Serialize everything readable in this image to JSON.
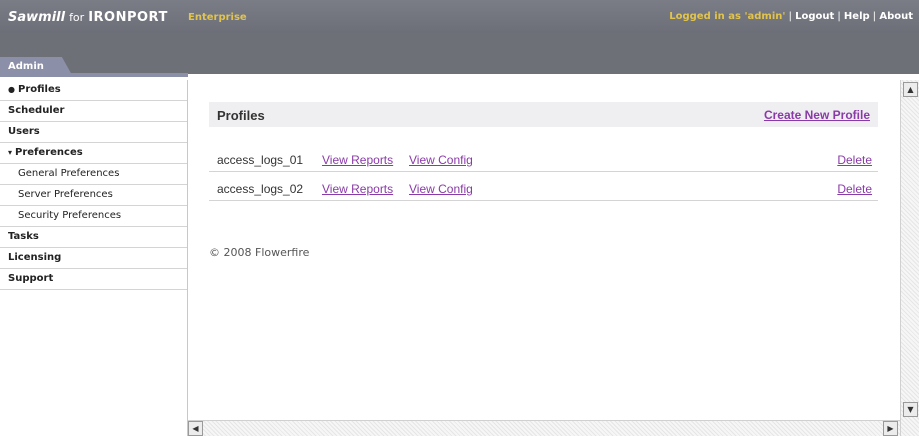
{
  "header": {
    "brand_app": "Sawmill",
    "brand_for": "for",
    "brand_vendor": "IRONPORT",
    "edition": "Enterprise",
    "login_text": "Logged in as 'admin'",
    "logout": "Logout",
    "help": "Help",
    "about": "About",
    "separator": "|"
  },
  "tab": {
    "label": "Admin"
  },
  "sidebar": {
    "items": [
      {
        "label": "Profiles",
        "prefix": "●"
      },
      {
        "label": "Scheduler"
      },
      {
        "label": "Users"
      },
      {
        "label": "Preferences",
        "prefix": "▾"
      },
      {
        "label": "General Preferences"
      },
      {
        "label": "Server Preferences"
      },
      {
        "label": "Security Preferences"
      },
      {
        "label": "Tasks"
      },
      {
        "label": "Licensing"
      },
      {
        "label": "Support"
      }
    ]
  },
  "main": {
    "title": "Profiles",
    "create_link": "Create New Profile",
    "profiles": [
      {
        "name": "access_logs_01",
        "view_reports": "View Reports",
        "view_config": "View Config",
        "delete": "Delete"
      },
      {
        "name": "access_logs_02",
        "view_reports": "View Reports",
        "view_config": "View Config",
        "delete": "Delete"
      }
    ],
    "copyright": "© 2008 Flowerfire"
  },
  "scrollbar": {
    "up": "▲",
    "down": "▼",
    "left": "◀",
    "right": "▶"
  },
  "colors": {
    "header_bg": "#6c6e78",
    "tab_bg": "#8b8fa8",
    "link": "#8a3aa8",
    "edition": "#e2c44c"
  }
}
